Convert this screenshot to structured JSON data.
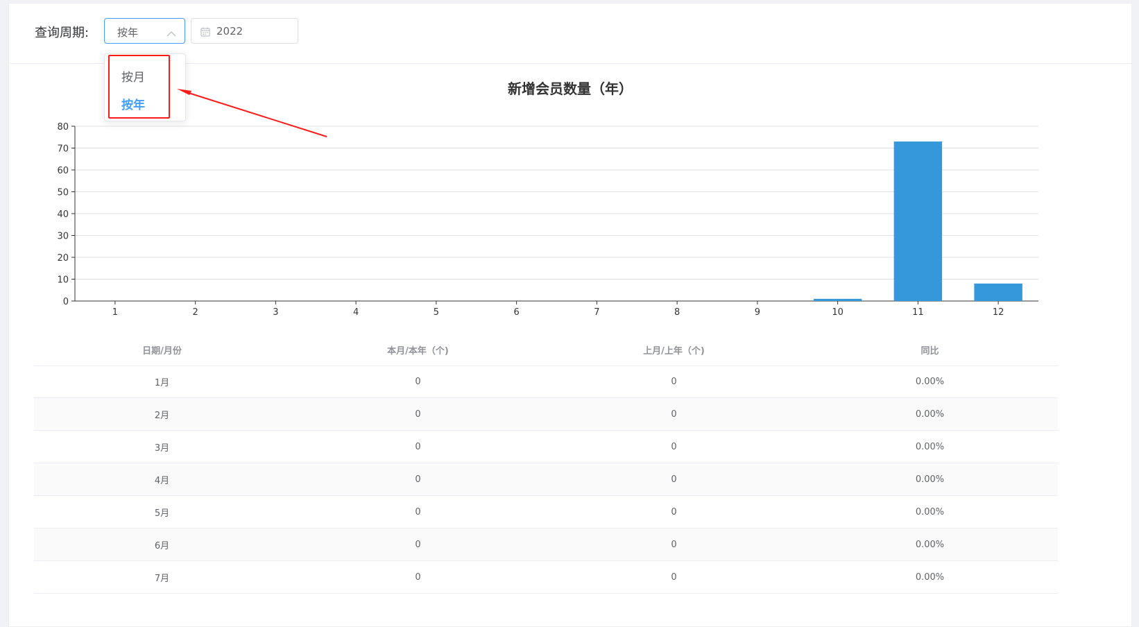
{
  "query": {
    "label": "查询周期:",
    "select_value": "按年",
    "date_value": "2022",
    "options": [
      {
        "label": "按月",
        "active": false
      },
      {
        "label": "按年",
        "active": true
      }
    ]
  },
  "chart_data": {
    "type": "bar",
    "title": "新增会员数量（年）",
    "categories": [
      "1",
      "2",
      "3",
      "4",
      "5",
      "6",
      "7",
      "8",
      "9",
      "10",
      "11",
      "12"
    ],
    "values": [
      0,
      0,
      0,
      0,
      0,
      0,
      0,
      0,
      0,
      1,
      73,
      8
    ],
    "ylim": [
      0,
      80
    ],
    "yticks": [
      0,
      10,
      20,
      30,
      40,
      50,
      60,
      70,
      80
    ],
    "grid": true,
    "bar_color": "#3498db"
  },
  "table": {
    "headers": [
      "日期/月份",
      "本月/本年（个)",
      "上月/上年（个)",
      "同比"
    ],
    "rows": [
      [
        "1月",
        "0",
        "0",
        "0.00%"
      ],
      [
        "2月",
        "0",
        "0",
        "0.00%"
      ],
      [
        "3月",
        "0",
        "0",
        "0.00%"
      ],
      [
        "4月",
        "0",
        "0",
        "0.00%"
      ],
      [
        "5月",
        "0",
        "0",
        "0.00%"
      ],
      [
        "6月",
        "0",
        "0",
        "0.00%"
      ],
      [
        "7月",
        "0",
        "0",
        "0.00%"
      ]
    ]
  },
  "colors": {
    "accent": "#409eff",
    "annotation": "#ff1a1a"
  }
}
